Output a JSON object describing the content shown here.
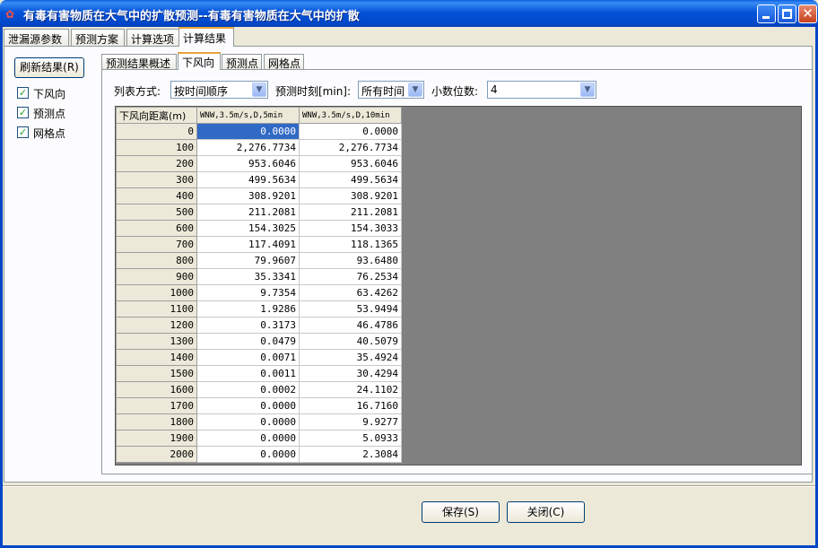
{
  "window": {
    "title": "有毒有害物质在大气中的扩散预测--有毒有害物质在大气中的扩散",
    "app_icon": "cloud-icon",
    "close_glyph": "✕"
  },
  "outer_tabs": [
    "泄漏源参数",
    "预测方案",
    "计算选项",
    "计算结果"
  ],
  "outer_tab_active": "计算结果",
  "refresh_label": "刷新结果(R)",
  "checkboxes": [
    {
      "label": "下风向",
      "checked": true,
      "mark": "✓"
    },
    {
      "label": "预测点",
      "checked": true,
      "mark": "✓"
    },
    {
      "label": "网格点",
      "checked": true,
      "mark": "✓"
    }
  ],
  "inner_tabs": [
    "预测结果概述",
    "下风向",
    "预测点",
    "网格点"
  ],
  "inner_tab_active": "下风向",
  "filters": {
    "list_mode_label": "列表方式:",
    "list_mode_value": "按时间顺序",
    "time_label": "预测时刻[min]:",
    "time_value": "所有时间",
    "decimals_label": "小数位数:",
    "decimals_value": "4",
    "arrow": "▼"
  },
  "table": {
    "headers": [
      "下风向距离(m)",
      "WNW,3.5m/s,D,5min",
      "WNW,3.5m/s,D,10min"
    ],
    "rows": [
      [
        "0",
        "0.0000",
        "0.0000"
      ],
      [
        "100",
        "2,276.7734",
        "2,276.7734"
      ],
      [
        "200",
        "953.6046",
        "953.6046"
      ],
      [
        "300",
        "499.5634",
        "499.5634"
      ],
      [
        "400",
        "308.9201",
        "308.9201"
      ],
      [
        "500",
        "211.2081",
        "211.2081"
      ],
      [
        "600",
        "154.3025",
        "154.3033"
      ],
      [
        "700",
        "117.4091",
        "118.1365"
      ],
      [
        "800",
        "79.9607",
        "93.6480"
      ],
      [
        "900",
        "35.3341",
        "76.2534"
      ],
      [
        "1000",
        "9.7354",
        "63.4262"
      ],
      [
        "1100",
        "1.9286",
        "53.9494"
      ],
      [
        "1200",
        "0.3173",
        "46.4786"
      ],
      [
        "1300",
        "0.0479",
        "40.5079"
      ],
      [
        "1400",
        "0.0071",
        "35.4924"
      ],
      [
        "1500",
        "0.0011",
        "30.4294"
      ],
      [
        "1600",
        "0.0002",
        "24.1102"
      ],
      [
        "1700",
        "0.0000",
        "16.7160"
      ],
      [
        "1800",
        "0.0000",
        "9.9277"
      ],
      [
        "1900",
        "0.0000",
        "5.0933"
      ],
      [
        "2000",
        "0.0000",
        "2.3084"
      ]
    ]
  },
  "buttons": {
    "save": "保存(S)",
    "close": "关闭(C)"
  },
  "colors": {
    "selection": "#316ac5",
    "titlebar": "#0553d8",
    "tab_accent": "#e8a33a"
  }
}
